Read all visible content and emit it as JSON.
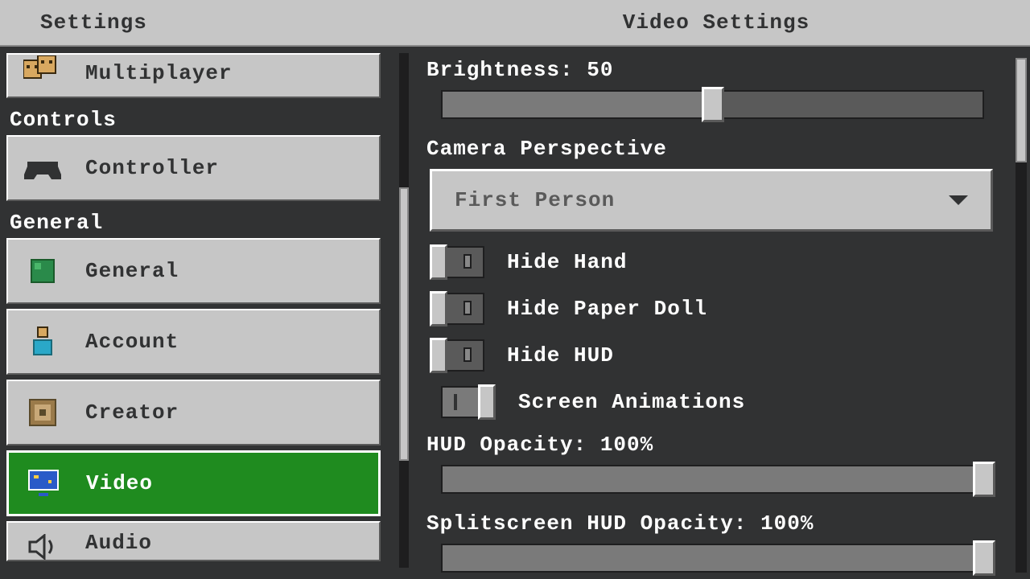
{
  "header": {
    "left": "Settings",
    "right": "Video Settings"
  },
  "sidebar": {
    "items": [
      {
        "label": "Multiplayer"
      }
    ],
    "controls_header": "Controls",
    "controls_items": [
      {
        "label": "Controller"
      }
    ],
    "general_header": "General",
    "general_items": [
      {
        "label": "General"
      },
      {
        "label": "Account"
      },
      {
        "label": "Creator"
      },
      {
        "label": "Video"
      },
      {
        "label": "Audio"
      }
    ]
  },
  "main": {
    "brightness_label": "Brightness: 50",
    "brightness_value": 50,
    "camera_label": "Camera Perspective",
    "camera_value": "First Person",
    "toggles": [
      {
        "label": "Hide Hand",
        "on": false
      },
      {
        "label": "Hide Paper Doll",
        "on": false
      },
      {
        "label": "Hide HUD",
        "on": false
      },
      {
        "label": "Screen Animations",
        "on": true
      }
    ],
    "hud_opacity_label": "HUD Opacity: 100%",
    "hud_opacity_value": 100,
    "splitscreen_label": "Splitscreen HUD Opacity: 100%",
    "splitscreen_value": 100
  }
}
